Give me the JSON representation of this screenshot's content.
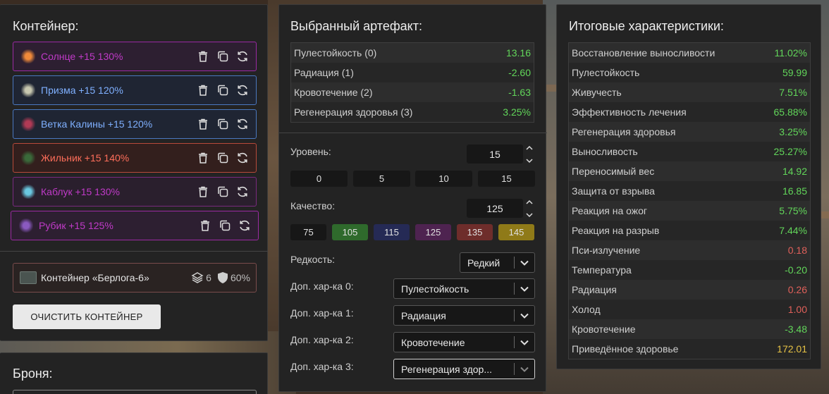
{
  "left": {
    "title": "Контейнер:",
    "items": [
      {
        "label": "Солнце +15 130%",
        "color": "#c03ac8",
        "border": "#9b2aa3",
        "bg": "#2d1f31",
        "icon": "sun-icon",
        "icon_color": "#f08a3a"
      },
      {
        "label": "Призма +15 120%",
        "color": "#7fb0ff",
        "border": "#4a78c0",
        "bg": "#1f2533",
        "icon": "prism-icon",
        "icon_color": "#c8c8b0"
      },
      {
        "label": "Ветка Калины +15 120%",
        "color": "#7fb0ff",
        "border": "#4a78c0",
        "bg": "#1f2533",
        "icon": "branch-icon",
        "icon_color": "#b03a55"
      },
      {
        "label": "Жильник +15 140%",
        "color": "#ff6e5a",
        "border": "#b84a3a",
        "bg": "#331f1d",
        "icon": "vein-icon",
        "icon_color": "#3a6a3a"
      },
      {
        "label": "Каблук +15 130%",
        "color": "#c03ac8",
        "border": "#7a2a80",
        "bg": "#2a1f2d",
        "icon": "heel-icon",
        "icon_color": "#6ac8e0"
      },
      {
        "label": "Рубик +15 125%",
        "color": "#c03ac8",
        "border": "#9b2aa3",
        "bg": "#2d1f31",
        "icon": "cube-icon",
        "icon_color": "#8a5ac0"
      }
    ],
    "container": {
      "name": "Контейнер «Берлога-6»",
      "slots": "6",
      "protection": "60%"
    },
    "clear_button": "ОЧИСТИТЬ КОНТЕЙНЕР"
  },
  "armor": {
    "title": "Броня:"
  },
  "middle": {
    "title": "Выбранный артефакт:",
    "stats": [
      {
        "name": "Пулестойкость (0)",
        "value": "13.16",
        "tone": "pos"
      },
      {
        "name": "Радиация (1)",
        "value": "-2.60",
        "tone": "pos"
      },
      {
        "name": "Кровотечение (2)",
        "value": "-1.63",
        "tone": "pos"
      },
      {
        "name": "Регенерация здоровья (3)",
        "value": "3.25%",
        "tone": "pos"
      }
    ],
    "level_label": "Уровень:",
    "level_value": "15",
    "level_presets": [
      "0",
      "5",
      "10",
      "15"
    ],
    "quality_label": "Качество:",
    "quality_value": "125",
    "quality_presets": [
      {
        "label": "75",
        "color": "#171717"
      },
      {
        "label": "105",
        "color": "#2f6a2c"
      },
      {
        "label": "115",
        "color": "#252a55"
      },
      {
        "label": "125",
        "color": "#4e2350"
      },
      {
        "label": "135",
        "color": "#6e2d2b"
      },
      {
        "label": "145",
        "color": "#8f7a18"
      }
    ],
    "rarity_label": "Редкость:",
    "rarity_value": "Редкий",
    "extra": [
      {
        "label": "Доп. хар-ка 0:",
        "value": "Пулестойкость"
      },
      {
        "label": "Доп. хар-ка 1:",
        "value": "Радиация"
      },
      {
        "label": "Доп. хар-ка 2:",
        "value": "Кровотечение"
      },
      {
        "label": "Доп. хар-ка 3:",
        "value": "Регенерация здор..."
      }
    ]
  },
  "right": {
    "title": "Итоговые характеристики:",
    "stats": [
      {
        "name": "Восстановление выносливости",
        "value": "11.02%",
        "tone": "pos"
      },
      {
        "name": "Пулестойкость",
        "value": "59.99",
        "tone": "pos"
      },
      {
        "name": "Живучесть",
        "value": "7.51%",
        "tone": "pos"
      },
      {
        "name": "Эффективность лечения",
        "value": "65.88%",
        "tone": "pos"
      },
      {
        "name": "Регенерация здоровья",
        "value": "3.25%",
        "tone": "pos"
      },
      {
        "name": "Выносливость",
        "value": "25.27%",
        "tone": "pos"
      },
      {
        "name": "Переносимый вес",
        "value": "14.92",
        "tone": "pos"
      },
      {
        "name": "Защита от взрыва",
        "value": "16.85",
        "tone": "pos"
      },
      {
        "name": "Реакция на ожог",
        "value": "5.75%",
        "tone": "pos"
      },
      {
        "name": "Реакция на разрыв",
        "value": "7.44%",
        "tone": "pos"
      },
      {
        "name": "Пси-излучение",
        "value": "0.18",
        "tone": "neg"
      },
      {
        "name": "Температура",
        "value": "-0.20",
        "tone": "pos"
      },
      {
        "name": "Радиация",
        "value": "0.26",
        "tone": "neg"
      },
      {
        "name": "Холод",
        "value": "1.00",
        "tone": "neg"
      },
      {
        "name": "Кровотечение",
        "value": "-3.48",
        "tone": "pos"
      },
      {
        "name": "Приведённое здоровье",
        "value": "172.01",
        "tone": "gold"
      }
    ]
  }
}
